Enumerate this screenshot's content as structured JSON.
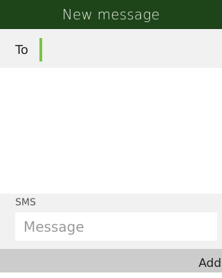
{
  "header": {
    "title": "New message"
  },
  "recipient": {
    "label": "To",
    "value": ""
  },
  "compose": {
    "channel_label": "SMS",
    "message_placeholder": "Message",
    "message_value": ""
  },
  "softkeys": {
    "right_label": "Add"
  },
  "colors": {
    "header_bg": "#1e4419",
    "cursor": "#76c442",
    "panel_bg": "#f1f1f1",
    "softkey_bar_bg": "#cccccc"
  }
}
